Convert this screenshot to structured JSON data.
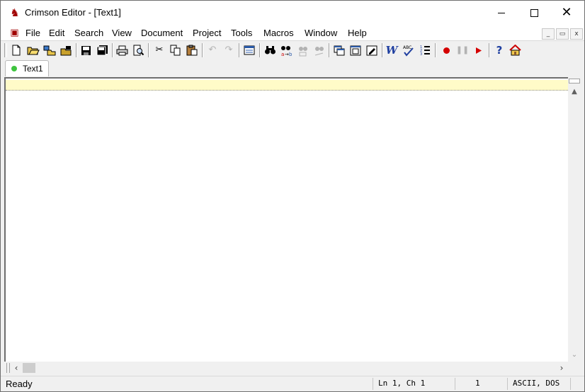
{
  "window": {
    "title": "Crimson Editor - [Text1]"
  },
  "menu": {
    "items": [
      "File",
      "Edit",
      "Search",
      "View",
      "Document",
      "Project",
      "Tools",
      "Macros",
      "Window",
      "Help"
    ]
  },
  "mdi_controls": {
    "minimize": "_",
    "restore": "▭",
    "close": "x"
  },
  "toolbar": {
    "buttons": [
      "new",
      "open",
      "open-remote",
      "close",
      "save",
      "save-all",
      "print",
      "print-preview",
      "cut",
      "copy",
      "paste",
      "undo",
      "redo",
      "toggle-view",
      "find",
      "replace",
      "find-in-files",
      "replace-in-files",
      "window-1",
      "window-2",
      "window-3",
      "word-wrap",
      "spell-check",
      "line-numbers",
      "record-macro",
      "pause-macro",
      "play-macro",
      "help",
      "home"
    ]
  },
  "tabs": [
    {
      "label": "Text1",
      "status_color": "#3fc43f"
    }
  ],
  "editor": {
    "content": "",
    "current_line_color": "#fffbc8"
  },
  "status": {
    "message": "Ready",
    "position": "Ln 1,  Ch 1",
    "column": "1",
    "encoding": "ASCII, DOS"
  }
}
